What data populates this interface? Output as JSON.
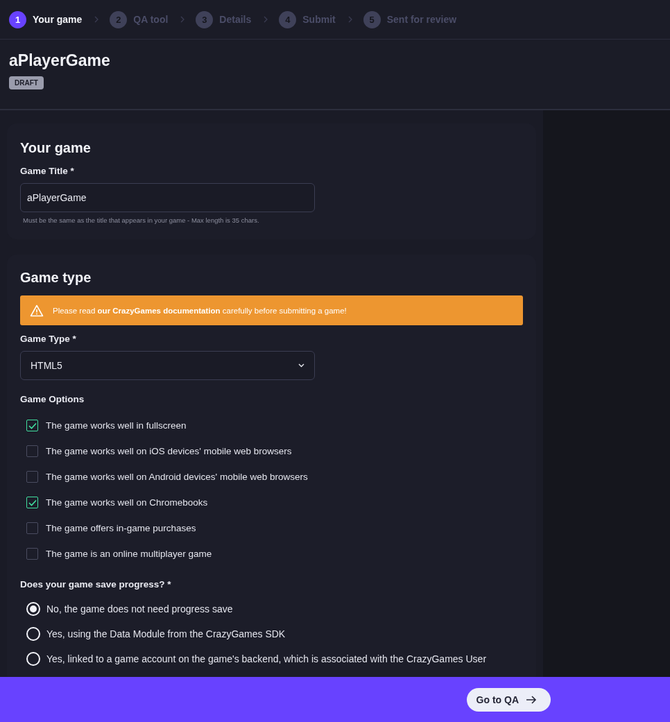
{
  "steps": [
    {
      "number": "1",
      "label": "Your game",
      "selected": true
    },
    {
      "number": "2",
      "label": "QA tool",
      "selected": false
    },
    {
      "number": "3",
      "label": "Details",
      "selected": false
    },
    {
      "number": "4",
      "label": "Submit",
      "selected": false
    },
    {
      "number": "5",
      "label": "Sent for review",
      "selected": false
    }
  ],
  "game": {
    "title": "aPlayerGame",
    "status": "DRAFT"
  },
  "your_game": {
    "heading": "Your game",
    "title_field": {
      "label": "Game Title *",
      "value": "aPlayerGame",
      "hint": "Must be the same as the title that appears in your game - Max length is 35 chars."
    }
  },
  "game_type": {
    "heading": "Game type",
    "notice": "Please read **our CrazyGames documentation** carefully before submitting a game!",
    "type_field": {
      "label": "Game Type *",
      "value": "HTML5"
    },
    "options_label": "Game Options",
    "options": [
      {
        "label": "The game works well in fullscreen",
        "checked": true
      },
      {
        "label": "The game works well on iOS devices' mobile web browsers",
        "checked": false
      },
      {
        "label": "The game works well on Android devices' mobile web browsers",
        "checked": false
      },
      {
        "label": "The game works well on Chromebooks",
        "checked": true
      },
      {
        "label": "The game offers in-game purchases",
        "checked": false
      },
      {
        "label": "The game is an online multiplayer game",
        "checked": false
      }
    ],
    "save_question": "Does your game save progress? *",
    "save_options": [
      {
        "label": "No, the game does not need progress save",
        "selected": true
      },
      {
        "label": "Yes, using the Data Module from the CrazyGames SDK",
        "selected": false
      },
      {
        "label": "Yes, linked to a game account on the game's backend, which is associated with the CrazyGames User",
        "selected": false
      }
    ]
  },
  "footer": {
    "button": "Go to QA"
  }
}
